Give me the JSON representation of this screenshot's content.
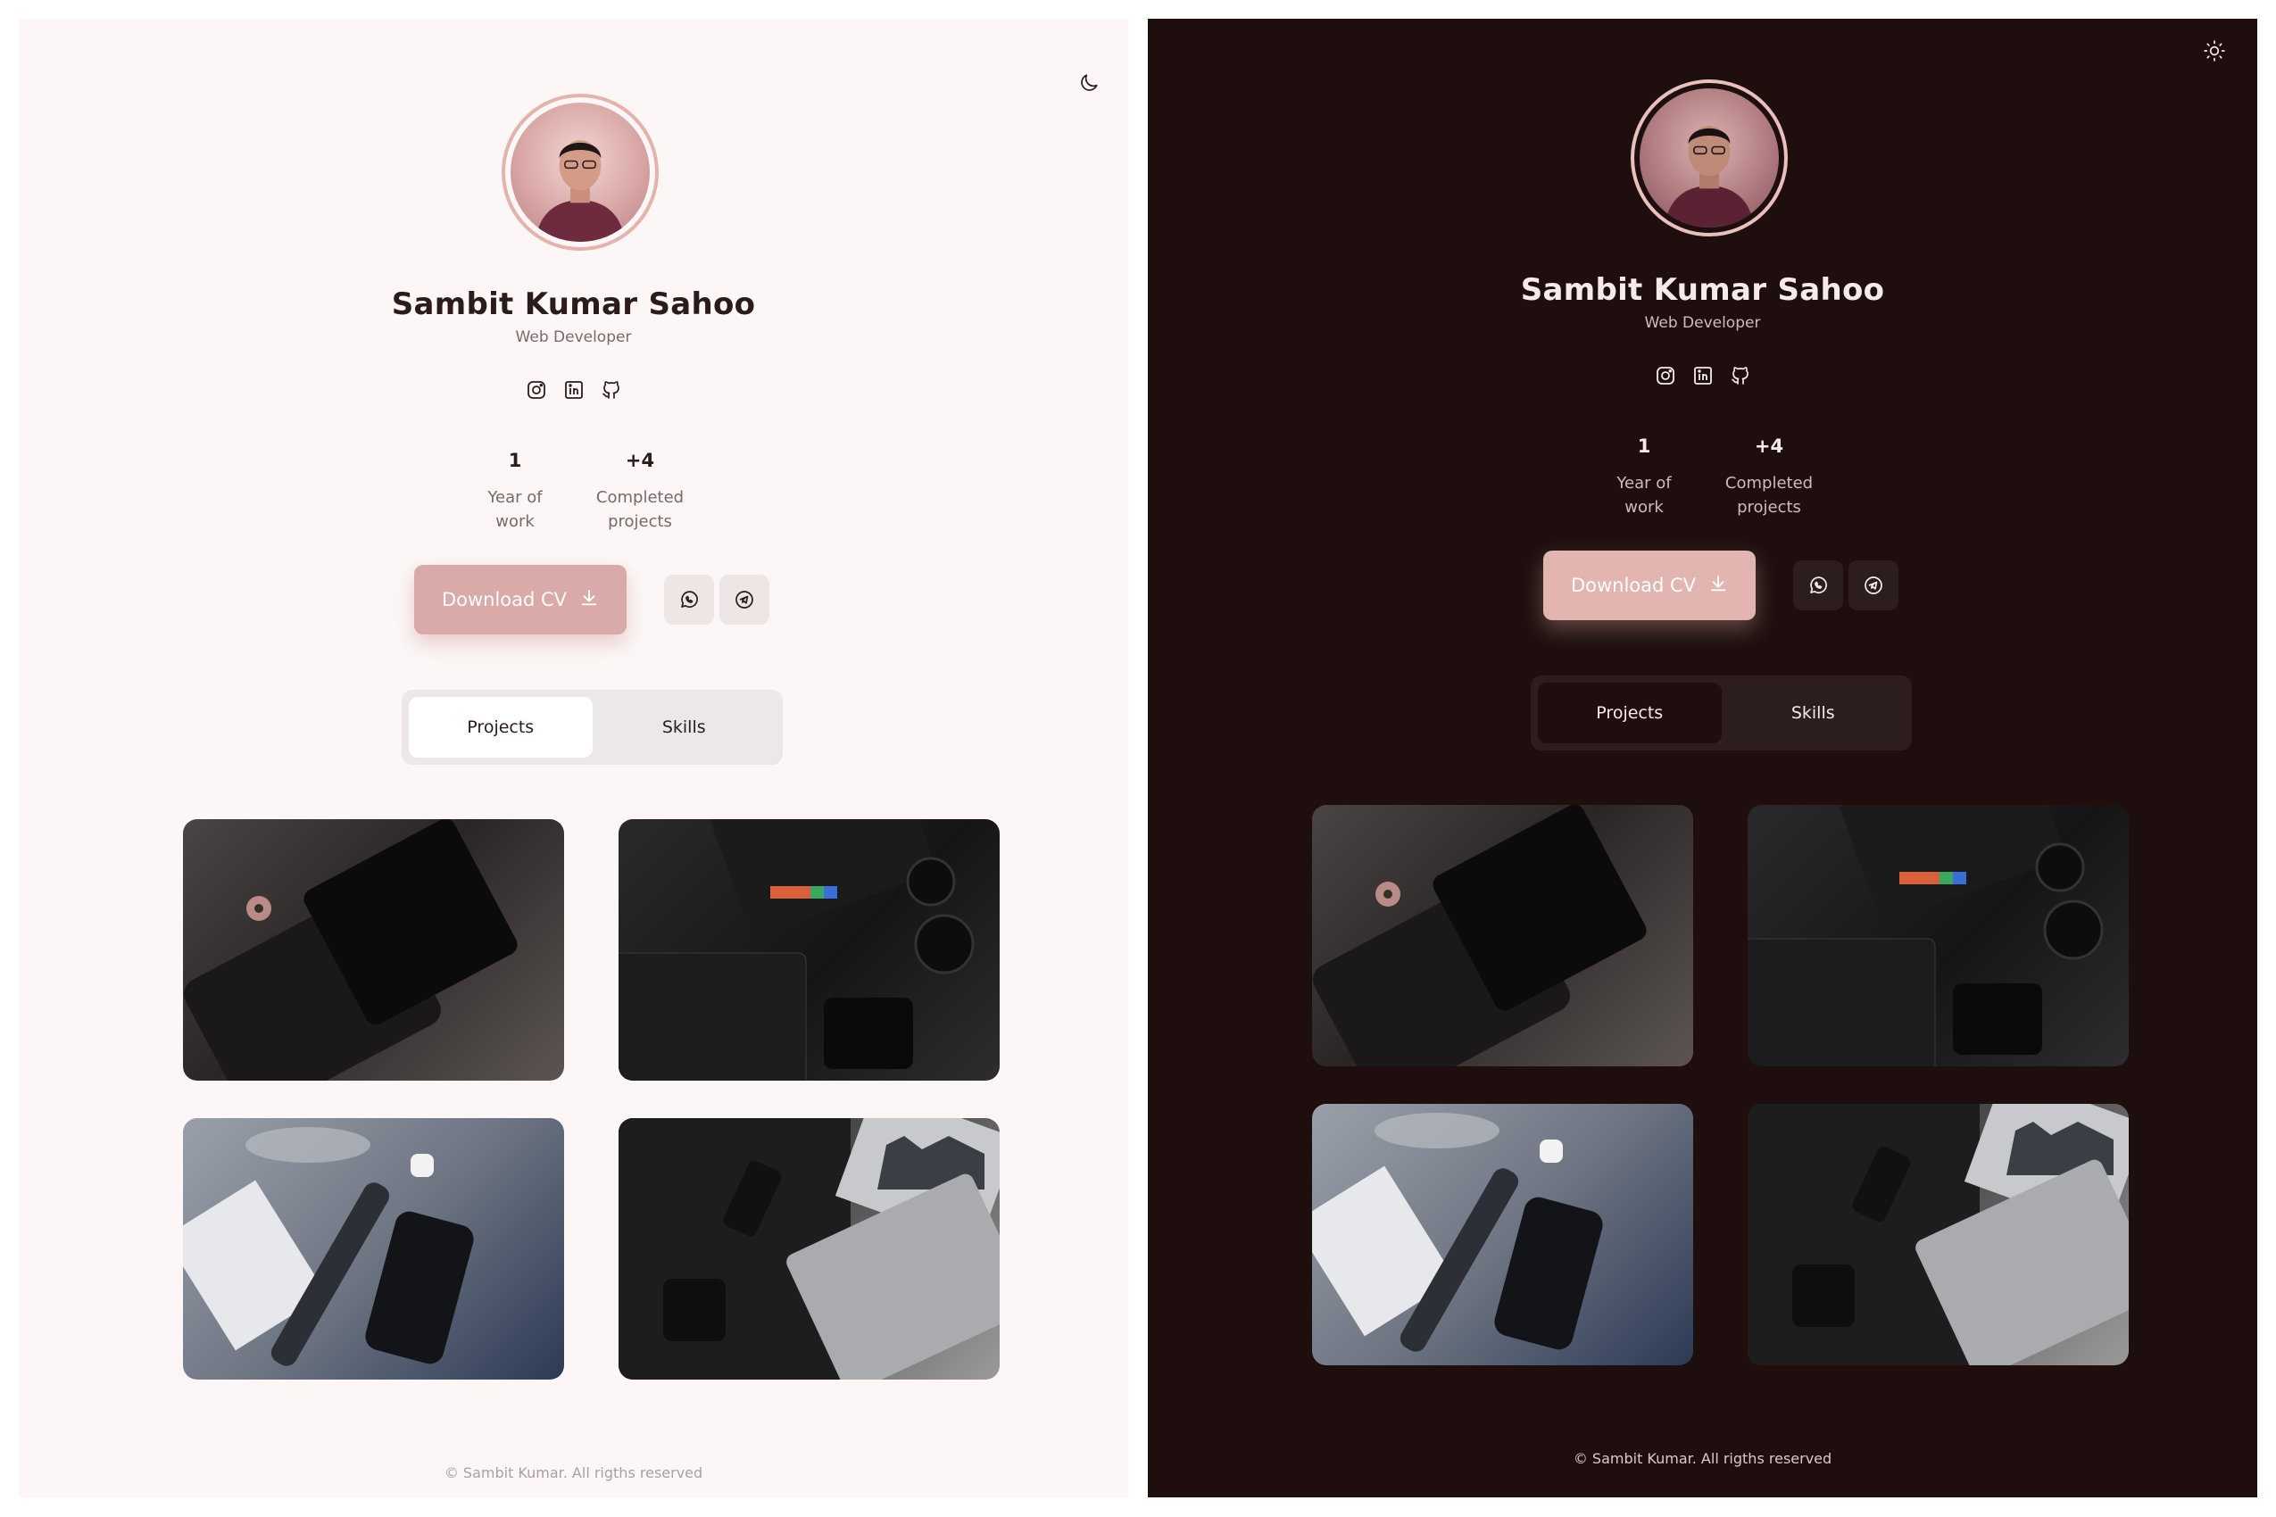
{
  "profile": {
    "name": "Sambit Kumar Sahoo",
    "role": "Web Developer"
  },
  "socials": [
    "instagram-icon",
    "linkedin-icon",
    "github-icon"
  ],
  "stats": [
    {
      "value": "1",
      "label_line1": "Year of",
      "label_line2": "work"
    },
    {
      "value": "+4",
      "label_line1": "Completed",
      "label_line2": "projects"
    }
  ],
  "actions": {
    "download_label": "Download CV",
    "icons": [
      "whatsapp-icon",
      "telegram-icon"
    ]
  },
  "tabs": [
    {
      "label": "Projects",
      "active": true
    },
    {
      "label": "Skills",
      "active": false
    }
  ],
  "gallery": [
    {
      "name": "project-image-1"
    },
    {
      "name": "project-image-2"
    },
    {
      "name": "project-image-3"
    },
    {
      "name": "project-image-4"
    }
  ],
  "footer": {
    "text": "© Sambit Kumar. All rigths reserved"
  },
  "themes": {
    "light": {
      "background": "#fcf7f6",
      "toggle_icon": "moon-icon"
    },
    "dark": {
      "background": "#1e0f0e",
      "toggle_icon": "sun-icon"
    }
  },
  "colors": {
    "accent": "#d9aaa7"
  }
}
